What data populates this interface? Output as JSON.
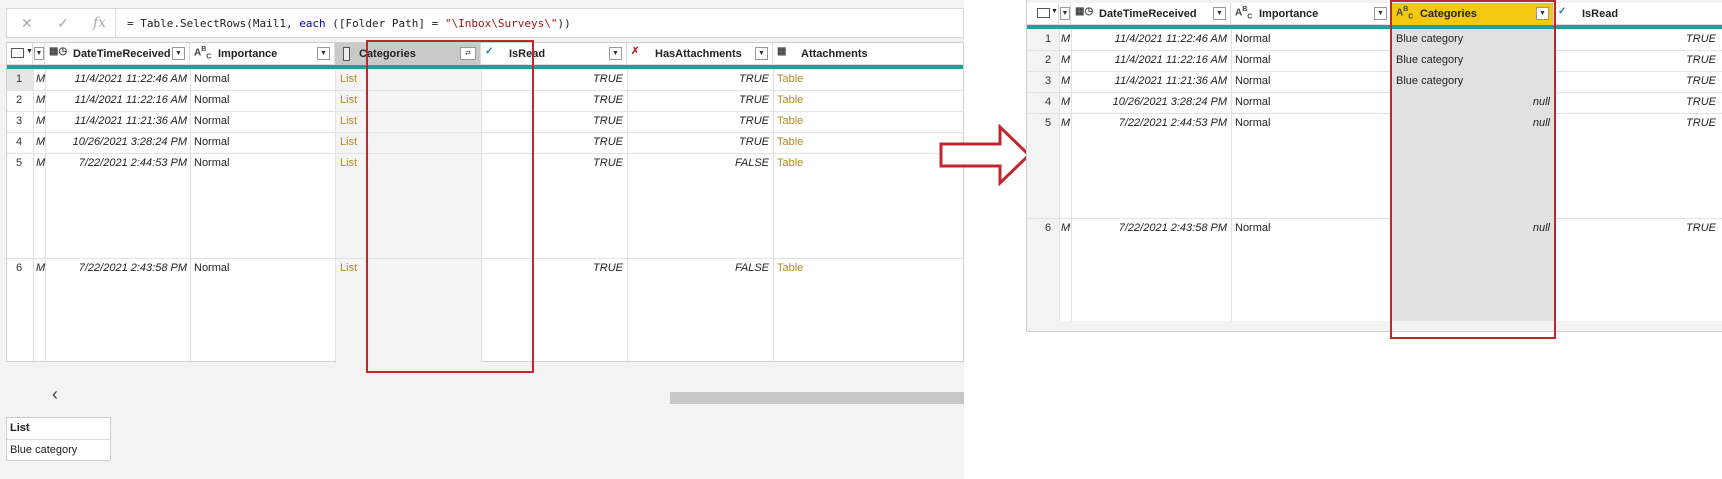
{
  "formula": {
    "prefix": "= Table.SelectRows(Mail1, ",
    "keyword": "each",
    "mid": " ([Folder Path] = ",
    "string": "\"\\Inbox\\Surveys\\\"",
    "suffix": "))"
  },
  "left_table": {
    "columns": [
      {
        "name": "DateTimeReceived",
        "icon": "calendar-clock-icon"
      },
      {
        "name": "Importance",
        "icon": "text-type-icon"
      },
      {
        "name": "Categories",
        "icon": "list-type-icon"
      },
      {
        "name": "IsRead",
        "icon": "boolean-type-icon"
      },
      {
        "name": "HasAttachments",
        "icon": "boolean-type-icon"
      },
      {
        "name": "Attachments",
        "icon": "table-type-icon"
      }
    ],
    "rows": [
      {
        "n": "1",
        "m": "M",
        "date": "11/4/2021 11:22:46 AM",
        "imp": "Normal",
        "cat": "List",
        "read": "TRUE",
        "att": "TRUE",
        "table": "Table"
      },
      {
        "n": "2",
        "m": "M",
        "date": "11/4/2021 11:22:16 AM",
        "imp": "Normal",
        "cat": "List",
        "read": "TRUE",
        "att": "TRUE",
        "table": "Table"
      },
      {
        "n": "3",
        "m": "M",
        "date": "11/4/2021 11:21:36 AM",
        "imp": "Normal",
        "cat": "List",
        "read": "TRUE",
        "att": "TRUE",
        "table": "Table"
      },
      {
        "n": "4",
        "m": "M",
        "date": "10/26/2021 3:28:24 PM",
        "imp": "Normal",
        "cat": "List",
        "read": "TRUE",
        "att": "TRUE",
        "table": "Table"
      },
      {
        "n": "5",
        "m": "M",
        "date": "7/22/2021 2:44:53 PM",
        "imp": "Normal",
        "cat": "List",
        "read": "TRUE",
        "att": "FALSE",
        "table": "Table"
      },
      {
        "n": "6",
        "m": "M",
        "date": "7/22/2021 2:43:58 PM",
        "imp": "Normal",
        "cat": "List",
        "read": "TRUE",
        "att": "FALSE",
        "table": "Table"
      }
    ]
  },
  "preview": {
    "header": "List",
    "value": "Blue category"
  },
  "right_table": {
    "columns": [
      {
        "name": "DateTimeReceived",
        "icon": "calendar-clock-icon"
      },
      {
        "name": "Importance",
        "icon": "text-type-icon"
      },
      {
        "name": "Categories",
        "icon": "text-type-icon"
      },
      {
        "name": "IsRead",
        "icon": "boolean-type-icon"
      }
    ],
    "rows": [
      {
        "n": "1",
        "m": "M",
        "date": "11/4/2021 11:22:46 AM",
        "imp": "Normal",
        "cat": "Blue category",
        "read": "TRUE"
      },
      {
        "n": "2",
        "m": "M",
        "date": "11/4/2021 11:22:16 AM",
        "imp": "Normal",
        "cat": "Blue category",
        "read": "TRUE"
      },
      {
        "n": "3",
        "m": "M",
        "date": "11/4/2021 11:21:36 AM",
        "imp": "Normal",
        "cat": "Blue category",
        "read": "TRUE"
      },
      {
        "n": "4",
        "m": "M",
        "date": "10/26/2021 3:28:24 PM",
        "imp": "Normal",
        "cat": "null",
        "read": "TRUE"
      },
      {
        "n": "5",
        "m": "M",
        "date": "7/22/2021 2:44:53 PM",
        "imp": "Normal",
        "cat": "null",
        "read": "TRUE"
      },
      {
        "n": "6",
        "m": "M",
        "date": "7/22/2021 2:43:58 PM",
        "imp": "Normal",
        "cat": "null",
        "read": "TRUE"
      }
    ]
  },
  "colors": {
    "accent_teal": "#1aa39a",
    "highlight_red": "#c0272d",
    "link_gold": "#b28b26",
    "selected_header_yellow": "#f2c811"
  }
}
